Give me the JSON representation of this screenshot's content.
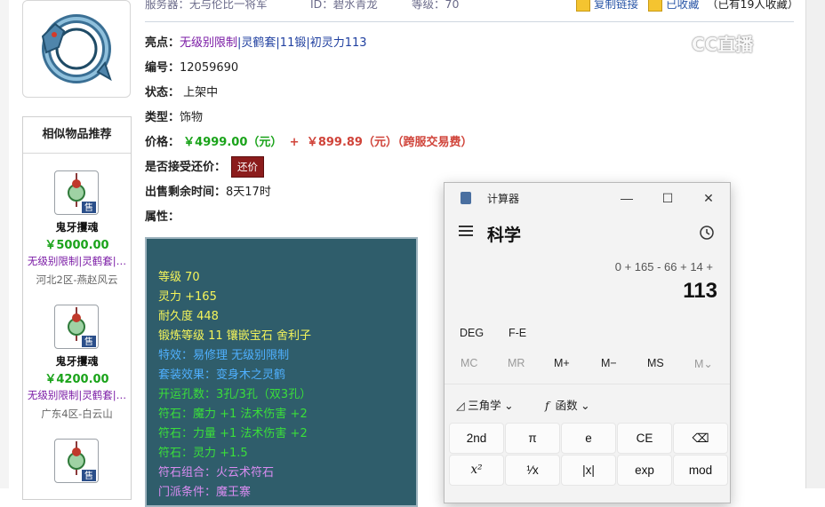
{
  "watermark": "CC直播",
  "top": {
    "server": "服务器：无与伦比一将军",
    "seller_id": "ID：碧水青龙",
    "level": "等级：70",
    "copy_link": "复制链接",
    "favorited": "已收藏",
    "fav_count": "（已有19人收藏）"
  },
  "item": {
    "highlights_label": "亮点：",
    "highlights": [
      "无级别限制",
      "|灵鹤套",
      "|11锻",
      "|初灵力113"
    ],
    "serial_label": "编号：",
    "serial": "12059690",
    "status_label": "状态：",
    "status": "上架中",
    "type_label": "类型：",
    "type": "饰物",
    "price_label": "价格：",
    "price": "￥4999.00（元）",
    "price_plus": "+",
    "fee": "￥899.89（元）（跨服交易费）",
    "haggle_label": "是否接受还价：",
    "haggle_button": "还价",
    "time_label": "出售剩余时间：",
    "time_left": "8天17时",
    "attr_label": "属性："
  },
  "attributes": [
    {
      "text": "等级 70",
      "color": "#f5f55a"
    },
    {
      "text": "灵力 +165",
      "color": "#f5f55a"
    },
    {
      "text": "耐久度 448",
      "color": "#f5f55a"
    },
    {
      "text": "锻炼等级 11 镶嵌宝石 舍利子",
      "color": "#f5f55a"
    },
    {
      "text": "特效：易修理 无级别限制",
      "color": "#4fb0ff"
    },
    {
      "text": "套装效果：变身木之灵鹤",
      "color": "#4fb0ff"
    },
    {
      "text": "开运孔数：3孔/3孔（双3孔）",
      "color": "#3adf3a"
    },
    {
      "text": "符石：魔力 +1 法术伤害 +2",
      "color": "#3adf3a"
    },
    {
      "text": "符石：力量 +1 法术伤害 +2",
      "color": "#3adf3a"
    },
    {
      "text": "符石：灵力 +1.5",
      "color": "#3adf3a"
    },
    {
      "text": "符石组合：火云术符石",
      "color": "#d88cf0"
    },
    {
      "text": "门派条件：魔王寨",
      "color": "#d88cf0"
    }
  ],
  "similar": {
    "title": "相似物品推荐",
    "items": [
      {
        "name": "鬼牙攫魂",
        "price": "￥5000.00",
        "tags": "无级别限制|灵鹤套|…",
        "server": "河北2区-燕赵风云"
      },
      {
        "name": "鬼牙攫魂",
        "price": "￥4200.00",
        "tags": "无级别限制|灵鹤套|…",
        "server": "广东4区-白云山"
      },
      {
        "name": "",
        "price": "",
        "tags": "",
        "server": ""
      }
    ],
    "badge": "售"
  },
  "calculator": {
    "app_name": "计算器",
    "mode": "科学",
    "expression": "0 + 165 - 66 + 14 +",
    "result": "113",
    "angle_mode": "DEG",
    "fe": "F-E",
    "memory": [
      "MC",
      "MR",
      "M+",
      "M−",
      "MS",
      "M⌄"
    ],
    "trig_label": "三角学",
    "func_label": "函数",
    "keys_row1": [
      "2nd",
      "π",
      "e",
      "CE",
      "⌫"
    ],
    "keys_row2": [
      "x²",
      "¹⁄x",
      "|x|",
      "exp",
      "mod"
    ]
  }
}
